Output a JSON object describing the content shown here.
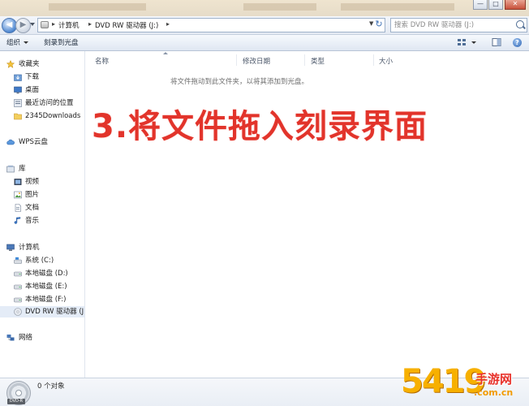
{
  "window": {
    "buttons": {
      "minimize": "—",
      "maximize": "□",
      "close": "✕"
    }
  },
  "address": {
    "crumbs": [
      "计算机",
      "DVD RW 驱动器 (J:)"
    ],
    "search_placeholder": "搜索 DVD RW 驱动器 (J:)"
  },
  "toolbar": {
    "organize": "组织",
    "burn": "刻录到光盘",
    "help": "?"
  },
  "navpane": {
    "favorites_header": "收藏夹",
    "favorites": [
      "下载",
      "桌面",
      "最近访问的位置",
      "2345Downloads"
    ],
    "wps": "WPS云盘",
    "library_header": "库",
    "libraries": [
      "视频",
      "图片",
      "文档",
      "音乐"
    ],
    "computer_header": "计算机",
    "drives": [
      "系统 (C:)",
      "本地磁盘 (D:)",
      "本地磁盘 (E:)",
      "本地磁盘 (F:)",
      "DVD RW 驱动器 (J"
    ],
    "network": "网络"
  },
  "content": {
    "columns": [
      "名称",
      "修改日期",
      "类型",
      "大小"
    ],
    "empty_hint": "将文件拖动到此文件夹，以将其添加到光盘。",
    "overlay_text": "3.将文件拖入刻录界面"
  },
  "details": {
    "object_count": "0 个对象",
    "drive_tag": "DVD-R"
  },
  "watermark": {
    "number": "5419",
    "cn": "手游网",
    "url": ".com.cn"
  },
  "colors": {
    "overlay_red": "#e2342b",
    "watermark_orange": "#f7b000",
    "selection": "#e4ecf7"
  }
}
